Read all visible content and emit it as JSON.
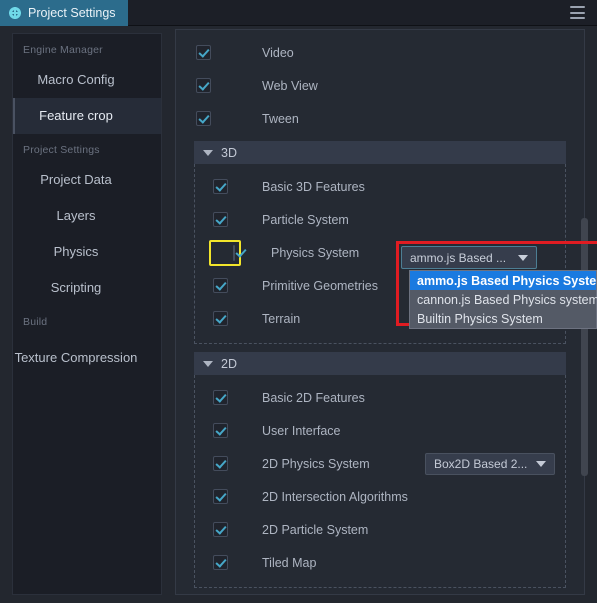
{
  "window": {
    "tab_label": "Project Settings",
    "gear_icon": "gear-icon",
    "menu_icon": "hamburger-menu-icon"
  },
  "sidebar": {
    "groups": [
      {
        "label": "Engine Manager",
        "items": [
          {
            "label": "Macro Config",
            "active": false
          },
          {
            "label": "Feature crop",
            "active": true
          }
        ]
      },
      {
        "label": "Project Settings",
        "items": [
          {
            "label": "Project Data",
            "active": false
          },
          {
            "label": "Layers",
            "active": false
          },
          {
            "label": "Physics",
            "active": false
          },
          {
            "label": "Scripting",
            "active": false
          }
        ]
      },
      {
        "label": "Build",
        "items": [
          {
            "label": "Texture Compression",
            "active": false
          }
        ]
      }
    ]
  },
  "main": {
    "top_rows": [
      {
        "label": "Video",
        "checked": true
      },
      {
        "label": "Web View",
        "checked": true
      },
      {
        "label": "Tween",
        "checked": true
      }
    ],
    "sections": [
      {
        "title": "3D",
        "expanded": true,
        "rows": [
          {
            "label": "Basic 3D Features",
            "checked": true
          },
          {
            "label": "Particle System",
            "checked": true
          },
          {
            "label": "Physics System",
            "checked": true,
            "highlighted": true
          },
          {
            "label": "Primitive Geometries",
            "checked": true
          },
          {
            "label": "Terrain",
            "checked": true
          }
        ]
      },
      {
        "title": "2D",
        "expanded": true,
        "rows": [
          {
            "label": "Basic 2D Features",
            "checked": true
          },
          {
            "label": "User Interface",
            "checked": true
          },
          {
            "label": "2D Physics System",
            "checked": true,
            "select": "Box2D Based 2..."
          },
          {
            "label": "2D Intersection Algorithms",
            "checked": true
          },
          {
            "label": "2D Particle System",
            "checked": true
          },
          {
            "label": "Tiled Map",
            "checked": true
          }
        ]
      }
    ]
  },
  "dropdown": {
    "closed_value": "ammo.js Based ...",
    "open": true,
    "options": [
      {
        "label": "ammo.js Based Physics System",
        "selected": true
      },
      {
        "label": "cannon.js Based Physics system",
        "selected": false
      },
      {
        "label": "Builtin Physics System",
        "selected": false
      }
    ]
  },
  "colors": {
    "accent_tab": "#2c6c8c",
    "highlight_option": "#1a7ae0",
    "annotation_red": "#e01c22",
    "annotation_yellow": "#f2e52b",
    "checkmark": "#46a7c8"
  }
}
